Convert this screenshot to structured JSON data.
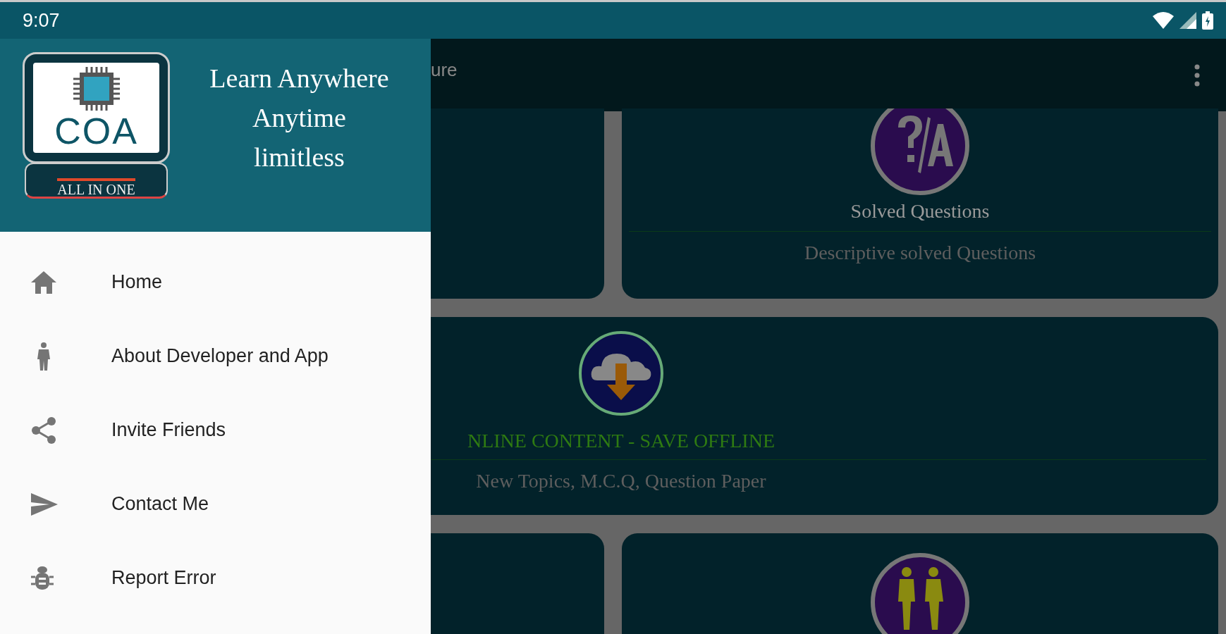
{
  "status_bar": {
    "time": "9:07"
  },
  "drawer": {
    "logo": {
      "caption": "COA",
      "base_caption": "ALL IN ONE"
    },
    "tagline": [
      "Learn Anywhere",
      "Anytime",
      "limitless"
    ],
    "items": [
      {
        "label": "Home"
      },
      {
        "label": "About Developer and App"
      },
      {
        "label": "Invite Friends"
      },
      {
        "label": "Contact Me"
      },
      {
        "label": "Report Error"
      }
    ]
  },
  "app_bar": {
    "title": "ure"
  },
  "cards": [
    {
      "kind": "blank"
    },
    {
      "kind": "topic",
      "title": "Solved Questions",
      "subtitle": "Descriptive solved Questions"
    },
    {
      "kind": "wide",
      "title": "NLINE CONTENT - SAVE OFFLINE",
      "subtitle": "New Topics, M.C.Q, Question Paper"
    },
    {
      "kind": "blank"
    },
    {
      "kind": "icon_only"
    }
  ]
}
